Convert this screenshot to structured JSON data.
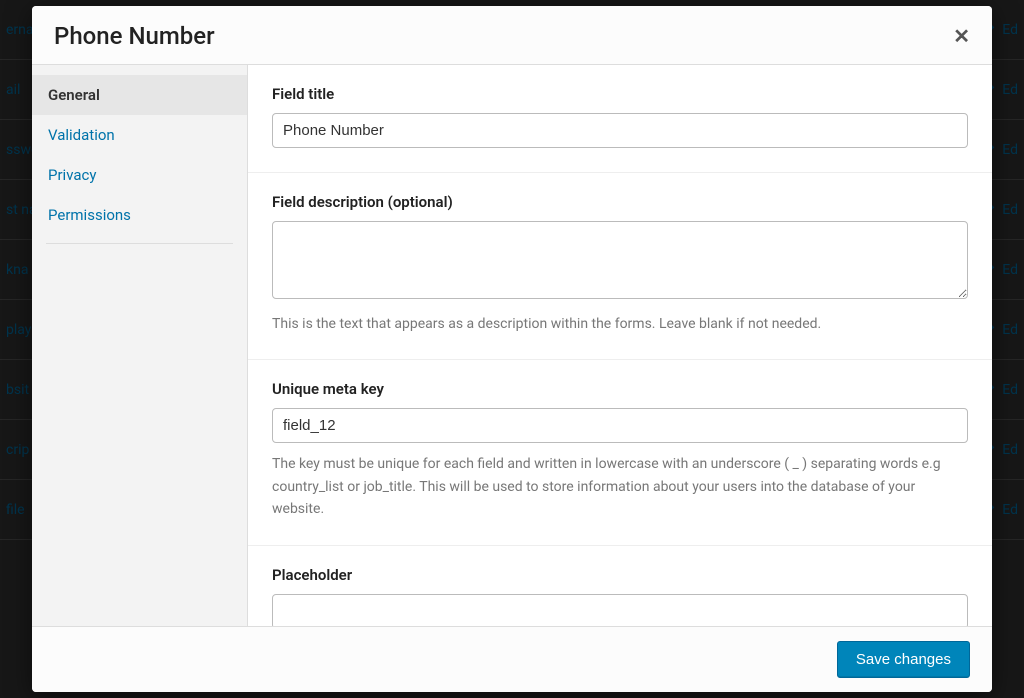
{
  "bg_rows": [
    "erna",
    "ail",
    "sswo",
    "st na",
    "kna",
    "play",
    "bsit",
    "crip",
    "file"
  ],
  "bg_edit": "Ed",
  "modal": {
    "title": "Phone Number",
    "sidebar": {
      "items": [
        {
          "label": "General",
          "active": true
        },
        {
          "label": "Validation",
          "active": false
        },
        {
          "label": "Privacy",
          "active": false
        },
        {
          "label": "Permissions",
          "active": false
        }
      ]
    },
    "fields": {
      "title": {
        "label": "Field title",
        "value": "Phone Number"
      },
      "description": {
        "label": "Field description (optional)",
        "value": "",
        "help": "This is the text that appears as a description within the forms. Leave blank if not needed."
      },
      "meta_key": {
        "label": "Unique meta key",
        "value": "field_12",
        "help": "The key must be unique for each field and written in lowercase with an underscore ( _ ) separating words e.g country_list or job_title. This will be used to store information about your users into the database of your website."
      },
      "placeholder": {
        "label": "Placeholder",
        "value": ""
      }
    },
    "footer": {
      "save": "Save changes"
    }
  }
}
